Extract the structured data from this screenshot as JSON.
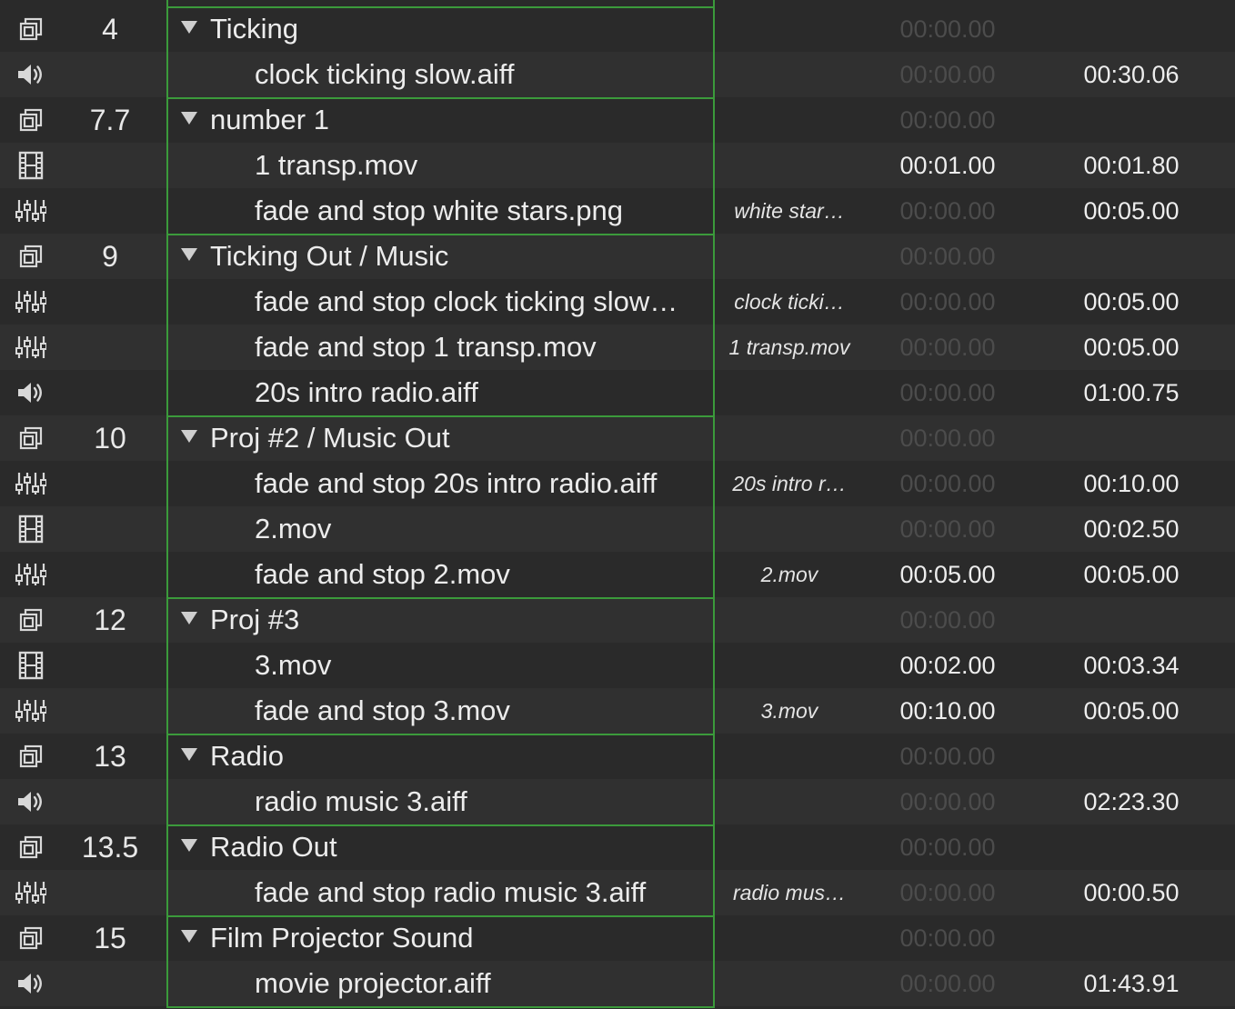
{
  "rows": [
    {
      "kind": "group",
      "icon": "group-cue-icon",
      "number": "4",
      "name": "Ticking",
      "target": "",
      "pre_wait": "00:00.00",
      "pre_dim": true,
      "duration": ""
    },
    {
      "kind": "child",
      "icon": "speaker-icon",
      "number": "",
      "name": "clock ticking slow.aiff",
      "target": "",
      "pre_wait": "00:00.00",
      "pre_dim": true,
      "duration": "00:30.06"
    },
    {
      "kind": "group",
      "icon": "group-cue-icon",
      "number": "7.7",
      "name": "number 1",
      "target": "",
      "pre_wait": "00:00.00",
      "pre_dim": true,
      "duration": ""
    },
    {
      "kind": "child",
      "icon": "film-icon",
      "number": "",
      "name": "1 transp.mov",
      "target": "",
      "pre_wait": "00:01.00",
      "pre_dim": false,
      "duration": "00:01.80"
    },
    {
      "kind": "child",
      "icon": "fader-icon",
      "number": "",
      "name": "fade and stop white stars.png",
      "target": "white star…",
      "pre_wait": "00:00.00",
      "pre_dim": true,
      "duration": "00:05.00"
    },
    {
      "kind": "group",
      "icon": "group-cue-icon",
      "number": "9",
      "name": "Ticking Out / Music",
      "target": "",
      "pre_wait": "00:00.00",
      "pre_dim": true,
      "duration": ""
    },
    {
      "kind": "child",
      "icon": "fader-icon",
      "number": "",
      "name": "fade and stop clock ticking slow…",
      "target": "clock ticki…",
      "pre_wait": "00:00.00",
      "pre_dim": true,
      "duration": "00:05.00"
    },
    {
      "kind": "child",
      "icon": "fader-icon",
      "number": "",
      "name": "fade and stop 1 transp.mov",
      "target": "1 transp.mov",
      "pre_wait": "00:00.00",
      "pre_dim": true,
      "duration": "00:05.00"
    },
    {
      "kind": "child",
      "icon": "speaker-icon",
      "number": "",
      "name": "20s intro radio.aiff",
      "target": "",
      "pre_wait": "00:00.00",
      "pre_dim": true,
      "duration": "01:00.75"
    },
    {
      "kind": "group",
      "icon": "group-cue-icon",
      "number": "10",
      "name": "Proj #2 / Music Out",
      "target": "",
      "pre_wait": "00:00.00",
      "pre_dim": true,
      "duration": ""
    },
    {
      "kind": "child",
      "icon": "fader-icon",
      "number": "",
      "name": "fade and stop 20s intro radio.aiff",
      "target": "20s intro r…",
      "pre_wait": "00:00.00",
      "pre_dim": true,
      "duration": "00:10.00"
    },
    {
      "kind": "child",
      "icon": "film-icon",
      "number": "",
      "name": "2.mov",
      "target": "",
      "pre_wait": "00:00.00",
      "pre_dim": true,
      "duration": "00:02.50"
    },
    {
      "kind": "child",
      "icon": "fader-icon",
      "number": "",
      "name": "fade and stop 2.mov",
      "target": "2.mov",
      "pre_wait": "00:05.00",
      "pre_dim": false,
      "duration": "00:05.00"
    },
    {
      "kind": "group",
      "icon": "group-cue-icon",
      "number": "12",
      "name": "Proj #3",
      "target": "",
      "pre_wait": "00:00.00",
      "pre_dim": true,
      "duration": ""
    },
    {
      "kind": "child",
      "icon": "film-icon",
      "number": "",
      "name": "3.mov",
      "target": "",
      "pre_wait": "00:02.00",
      "pre_dim": false,
      "duration": "00:03.34"
    },
    {
      "kind": "child",
      "icon": "fader-icon",
      "number": "",
      "name": "fade and stop 3.mov",
      "target": "3.mov",
      "pre_wait": "00:10.00",
      "pre_dim": false,
      "duration": "00:05.00"
    },
    {
      "kind": "group",
      "icon": "group-cue-icon",
      "number": "13",
      "name": "Radio",
      "target": "",
      "pre_wait": "00:00.00",
      "pre_dim": true,
      "duration": ""
    },
    {
      "kind": "child",
      "icon": "speaker-icon",
      "number": "",
      "name": "radio music 3.aiff",
      "target": "",
      "pre_wait": "00:00.00",
      "pre_dim": true,
      "duration": "02:23.30"
    },
    {
      "kind": "group",
      "icon": "group-cue-icon",
      "number": "13.5",
      "name": "Radio Out",
      "target": "",
      "pre_wait": "00:00.00",
      "pre_dim": true,
      "duration": ""
    },
    {
      "kind": "child",
      "icon": "fader-icon",
      "number": "",
      "name": "fade and stop radio music 3.aiff",
      "target": "radio mus…",
      "pre_wait": "00:00.00",
      "pre_dim": true,
      "duration": "00:00.50"
    },
    {
      "kind": "group",
      "icon": "group-cue-icon",
      "number": "15",
      "name": "Film Projector Sound",
      "target": "",
      "pre_wait": "00:00.00",
      "pre_dim": true,
      "duration": ""
    },
    {
      "kind": "child",
      "icon": "speaker-icon",
      "number": "",
      "name": "movie projector.aiff",
      "target": "",
      "pre_wait": "00:00.00",
      "pre_dim": true,
      "duration": "01:43.91"
    }
  ],
  "colors": {
    "group_border": "#3b9a3b",
    "row_odd": "#2a2a2a",
    "row_even": "#303030",
    "dim_text": "#4c4c4c",
    "text": "#ececec"
  }
}
